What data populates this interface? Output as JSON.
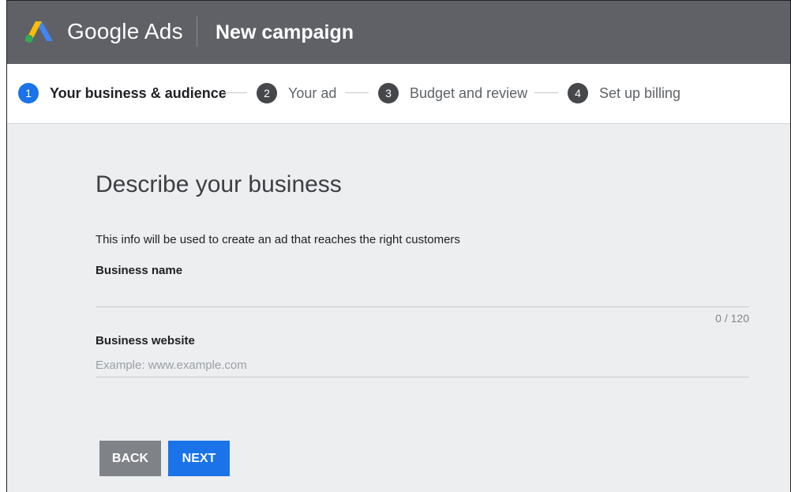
{
  "header": {
    "brand": "Google Ads",
    "title": "New campaign"
  },
  "stepper": {
    "steps": [
      {
        "number": "1",
        "label": "Your business & audience",
        "active": true
      },
      {
        "number": "2",
        "label": "Your ad",
        "active": false
      },
      {
        "number": "3",
        "label": "Budget and review",
        "active": false
      },
      {
        "number": "4",
        "label": "Set up billing",
        "active": false
      }
    ]
  },
  "form": {
    "title": "Describe your business",
    "description": "This info will be used to create an ad that reaches the right customers",
    "business_name": {
      "label": "Business name",
      "value": "",
      "placeholder": "",
      "counter": "0 / 120"
    },
    "business_website": {
      "label": "Business website",
      "value": "",
      "placeholder": "Example: www.example.com"
    }
  },
  "buttons": {
    "back": "BACK",
    "next": "NEXT"
  },
  "colors": {
    "header_bg": "#5f6166",
    "accent": "#1a73e8",
    "page_bg": "#edeef0",
    "back_button": "#7f8287"
  },
  "icons": {
    "logo": "google-ads-logo-icon"
  }
}
